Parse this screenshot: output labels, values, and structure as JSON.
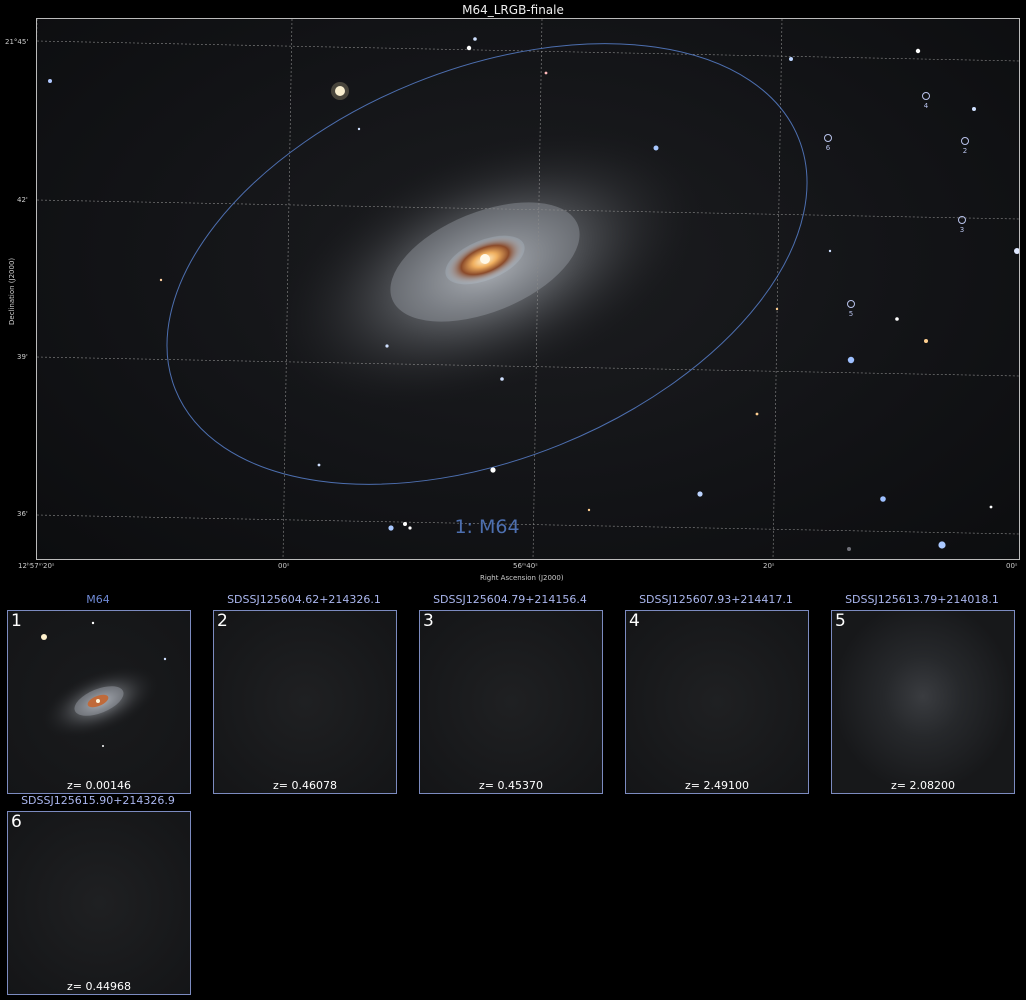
{
  "title": "M64_LRGB-finale",
  "main_plot": {
    "x_axis_title": "Right Ascension (J2000)",
    "y_axis_title": "Declination (J2000)",
    "x_ticks": [
      "12ʰ57ᵐ20ˢ",
      "00ˢ",
      "56ᵐ40ˢ",
      "20ˢ",
      "00ˢ"
    ],
    "y_ticks": [
      "21°45'",
      "42'",
      "39'",
      "36'"
    ],
    "target_label": "1: M64",
    "marker_labels": [
      "4",
      "6",
      "2",
      "3",
      "5"
    ],
    "colors": {
      "ellipse": "#4d6fb0",
      "grid": "#8a8a8a",
      "marker": "#b9c3ec"
    }
  },
  "cutouts": [
    {
      "number": "1",
      "name": "M64",
      "z": "z= 0.00146"
    },
    {
      "number": "2",
      "name": "SDSSJ125604.62+214326.1",
      "z": "z= 0.46078"
    },
    {
      "number": "3",
      "name": "SDSSJ125604.79+214156.4",
      "z": "z= 0.45370"
    },
    {
      "number": "4",
      "name": "SDSSJ125607.93+214417.1",
      "z": "z= 2.49100"
    },
    {
      "number": "5",
      "name": "SDSSJ125613.79+214018.1",
      "z": "z= 2.08200"
    },
    {
      "number": "6",
      "name": "SDSSJ125615.90+214326.9",
      "z": "z= 0.44968"
    }
  ]
}
